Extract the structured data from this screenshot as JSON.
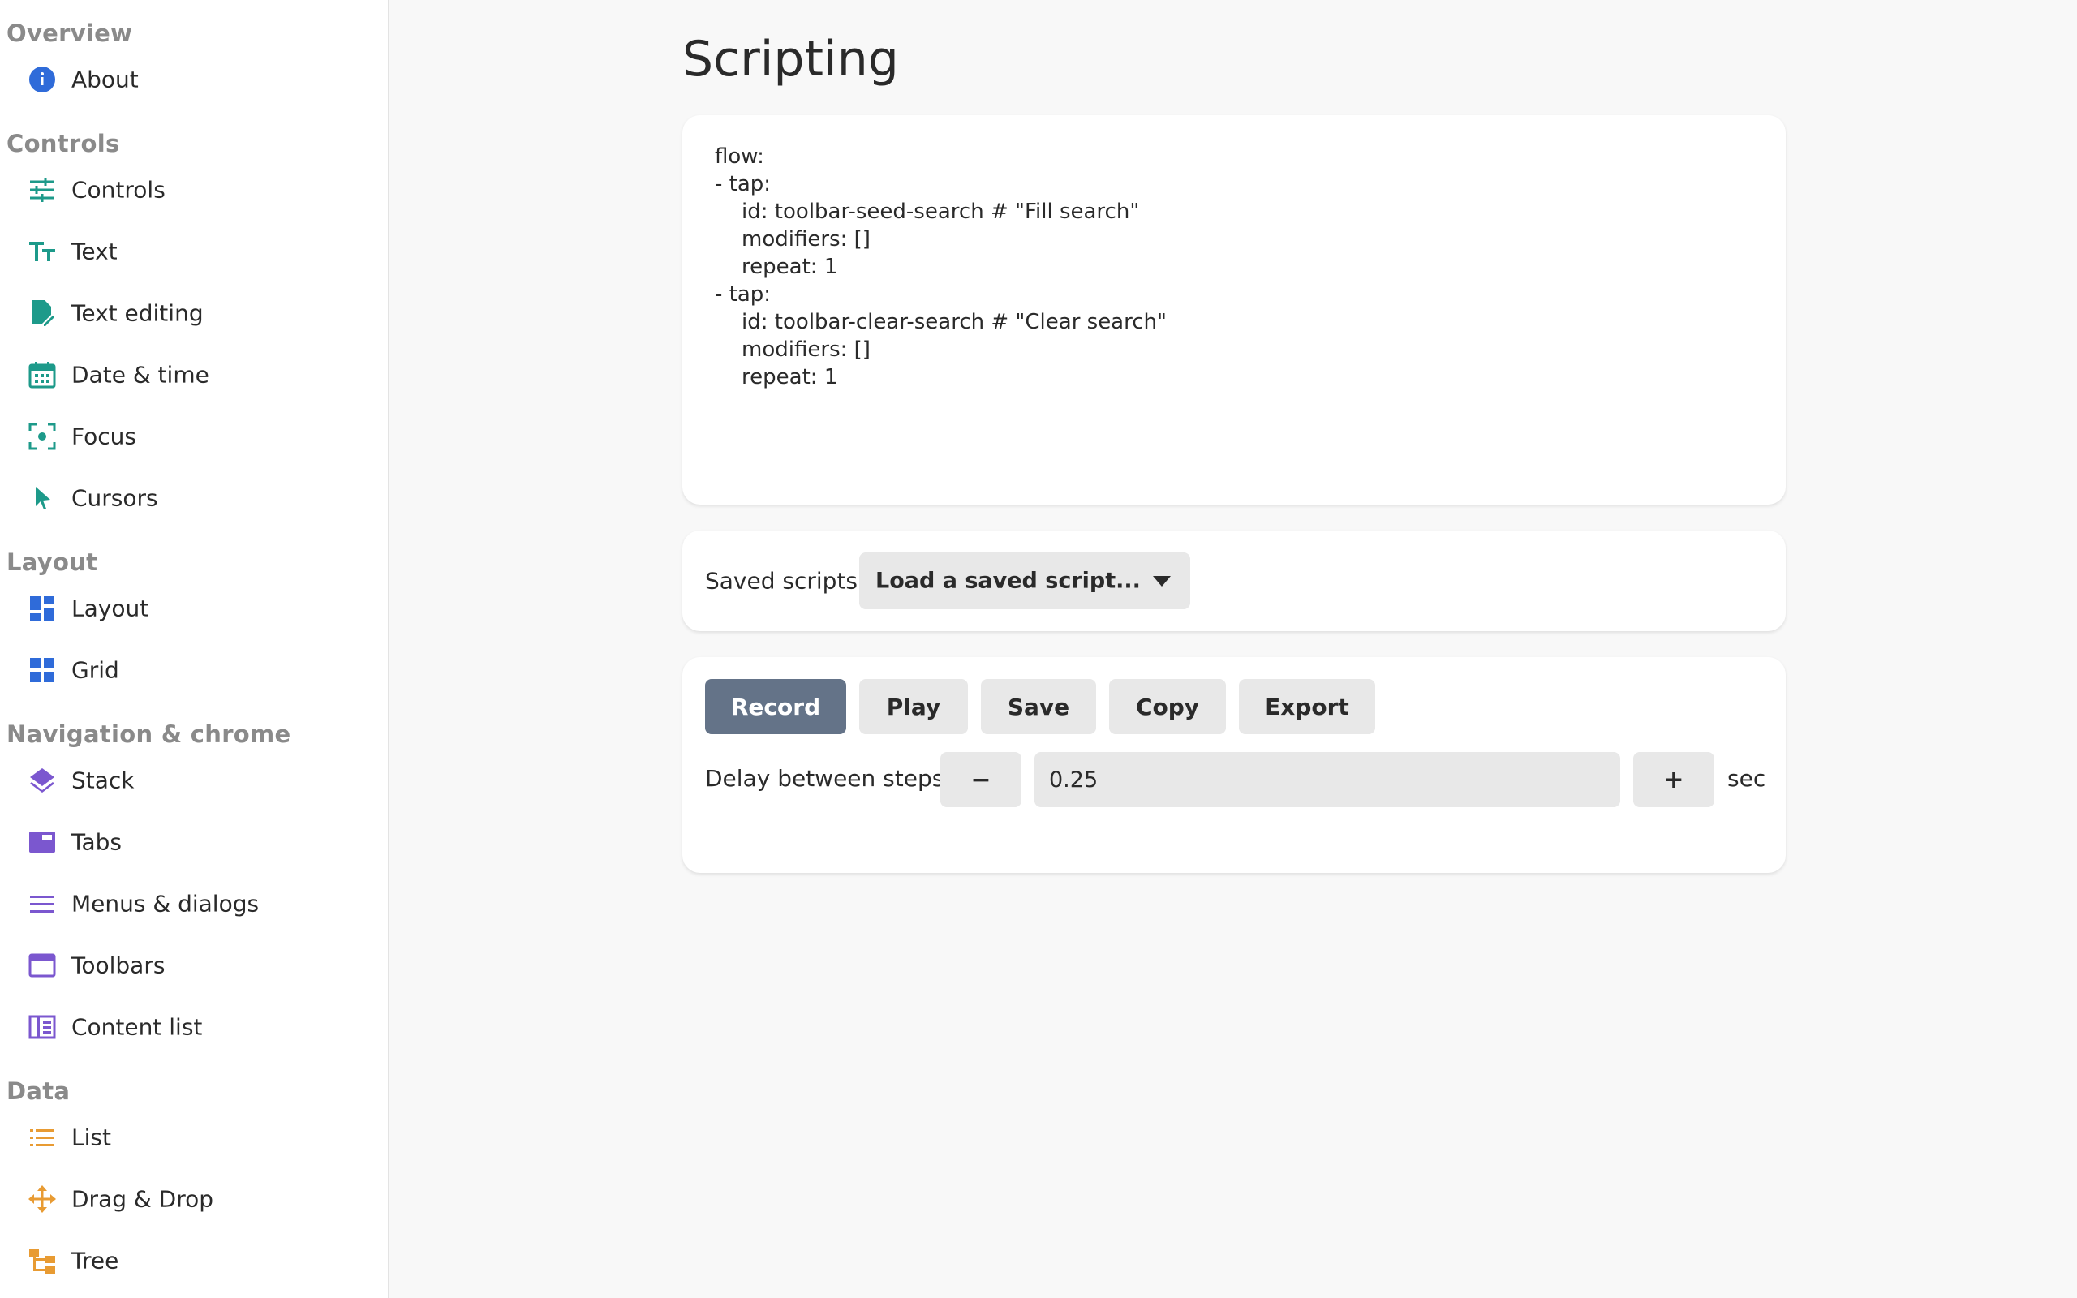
{
  "sidebar": {
    "sections": {
      "overview": "Overview",
      "controls": "Controls",
      "layout": "Layout",
      "navigation": "Navigation & chrome",
      "data": "Data"
    },
    "items": {
      "about": "About",
      "controls": "Controls",
      "text": "Text",
      "text_editing": "Text editing",
      "date_time": "Date & time",
      "focus": "Focus",
      "cursors": "Cursors",
      "layout": "Layout",
      "grid": "Grid",
      "stack": "Stack",
      "tabs": "Tabs",
      "menus": "Menus & dialogs",
      "toolbars": "Toolbars",
      "content_list": "Content list",
      "list": "List",
      "drag_drop": "Drag & Drop",
      "tree": "Tree"
    },
    "colors": {
      "blue": "#2f6bd9",
      "teal": "#1d9a8a",
      "purple": "#7b57cf",
      "orange": "#e89b33"
    }
  },
  "main": {
    "title": "Scripting",
    "script_text": "flow:\n- tap:\n    id: toolbar-seed-search # \"Fill search\"\n    modifiers: []\n    repeat: 1\n- tap:\n    id: toolbar-clear-search # \"Clear search\"\n    modifiers: []\n    repeat: 1",
    "saved": {
      "label": "Saved scripts",
      "dropdown": "Load a saved script..."
    },
    "actions": {
      "record": "Record",
      "play": "Play",
      "save": "Save",
      "copy": "Copy",
      "export": "Export"
    },
    "delay": {
      "label": "Delay between steps",
      "minus": "−",
      "value": "0.25",
      "plus": "+",
      "unit": "sec"
    }
  }
}
